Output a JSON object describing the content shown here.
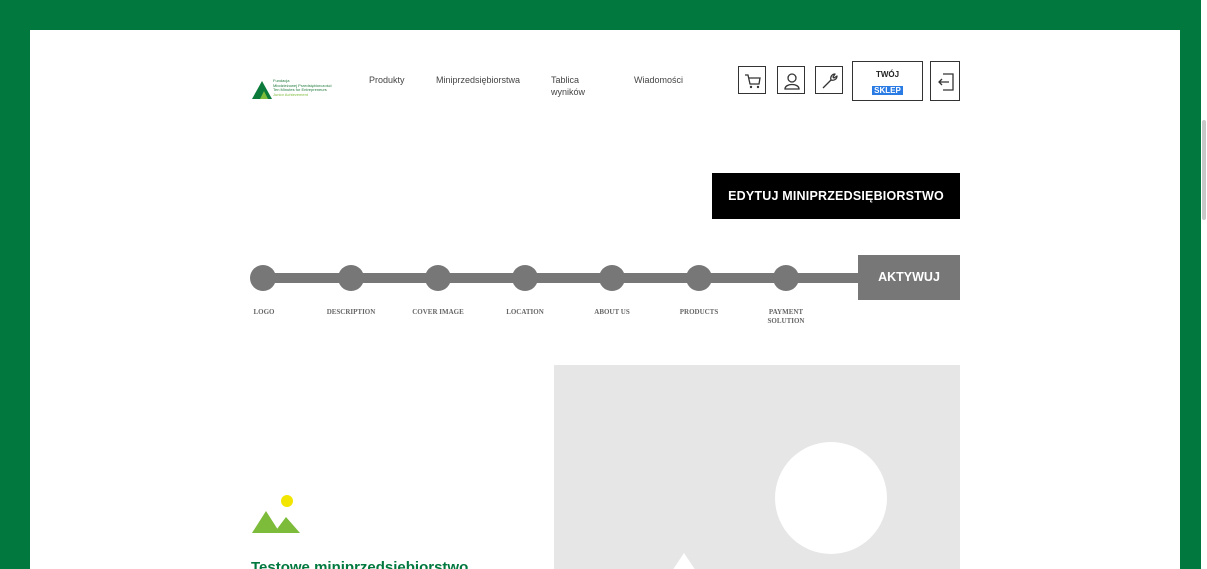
{
  "nav": {
    "items": [
      {
        "label": "Produkty"
      },
      {
        "label": "Miniprzedsiębiorstwa"
      },
      {
        "label": "Tablica wyników"
      },
      {
        "label": "Wiadomości"
      }
    ]
  },
  "logo": {
    "lines": [
      "Fundacja",
      "Młodzieżowej Przedsiębiorczości",
      "Ten Minutes for Entrepreneurs",
      "Junior Achievement"
    ],
    "icon": "triangle-tree-icon"
  },
  "header_icons": {
    "cart": "cart-icon",
    "user": "user-icon",
    "tools": "wrench-icon",
    "logout": "logout-icon"
  },
  "shop": {
    "line1": "TWÓJ",
    "line2": "SKLEP"
  },
  "actions": {
    "edit_label": "EDYTUJ MINIPRZEDSIĘBIORSTWO",
    "activate_label": "AKTYWUJ"
  },
  "steps": [
    {
      "label": "LOGO"
    },
    {
      "label": "DESCRIPTION"
    },
    {
      "label": "COVER IMAGE"
    },
    {
      "label": "LOCATION"
    },
    {
      "label": "ABOUT US"
    },
    {
      "label": "PRODUCTS"
    },
    {
      "label": "PAYMENT SOLUTION"
    }
  ],
  "company": {
    "name": "Testowe miniprzedsiębiorstwo",
    "logo_icon": "image-placeholder-icon"
  },
  "colors": {
    "brand_green": "#00783e",
    "step_gray": "#777777",
    "placeholder_gray": "#e6e6e6",
    "highlight_blue": "#2b7be4"
  }
}
